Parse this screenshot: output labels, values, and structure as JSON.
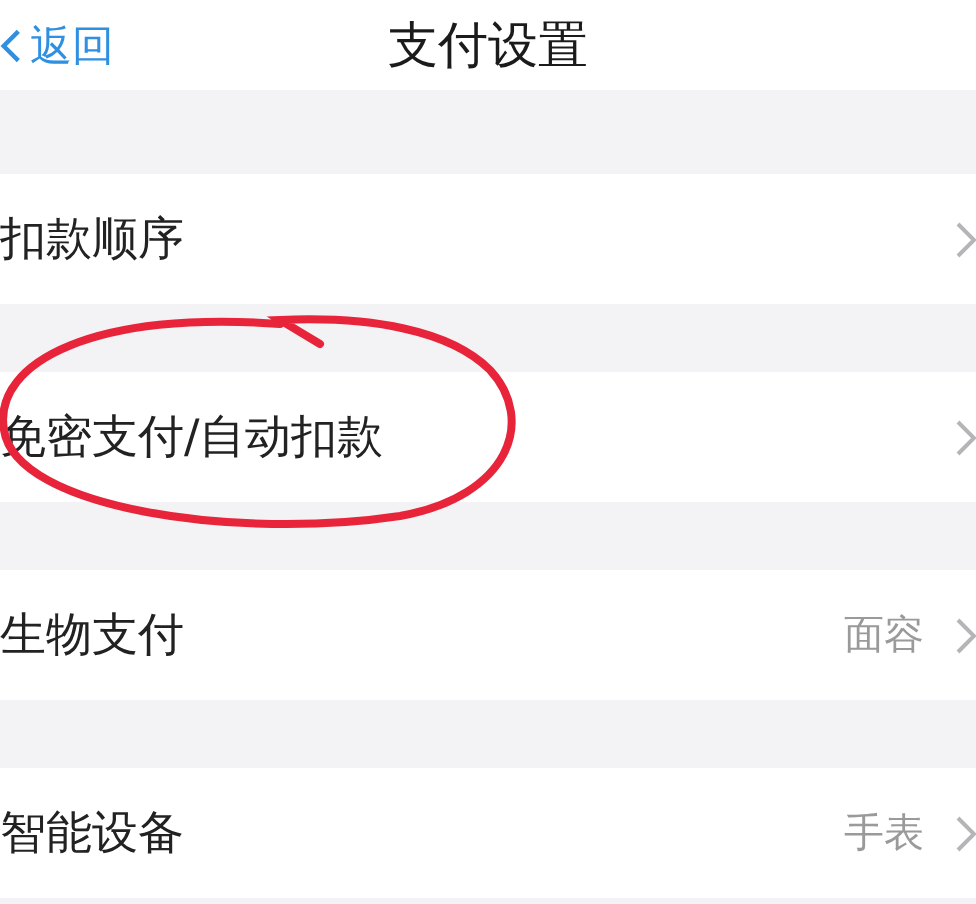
{
  "nav_bar": {
    "back": "返回",
    "title": "支付设置"
  },
  "sections": [
    {
      "rows": [
        {
          "label": "扣款顺序"
        }
      ]
    },
    {
      "rows": [
        {
          "label": "免密支付/自动扣款"
        }
      ]
    },
    {
      "rows": [
        {
          "label": "生物支付",
          "value": "面容"
        }
      ]
    },
    {
      "rows": [
        {
          "label": "智能设备",
          "value": "手表"
        }
      ]
    }
  ]
}
